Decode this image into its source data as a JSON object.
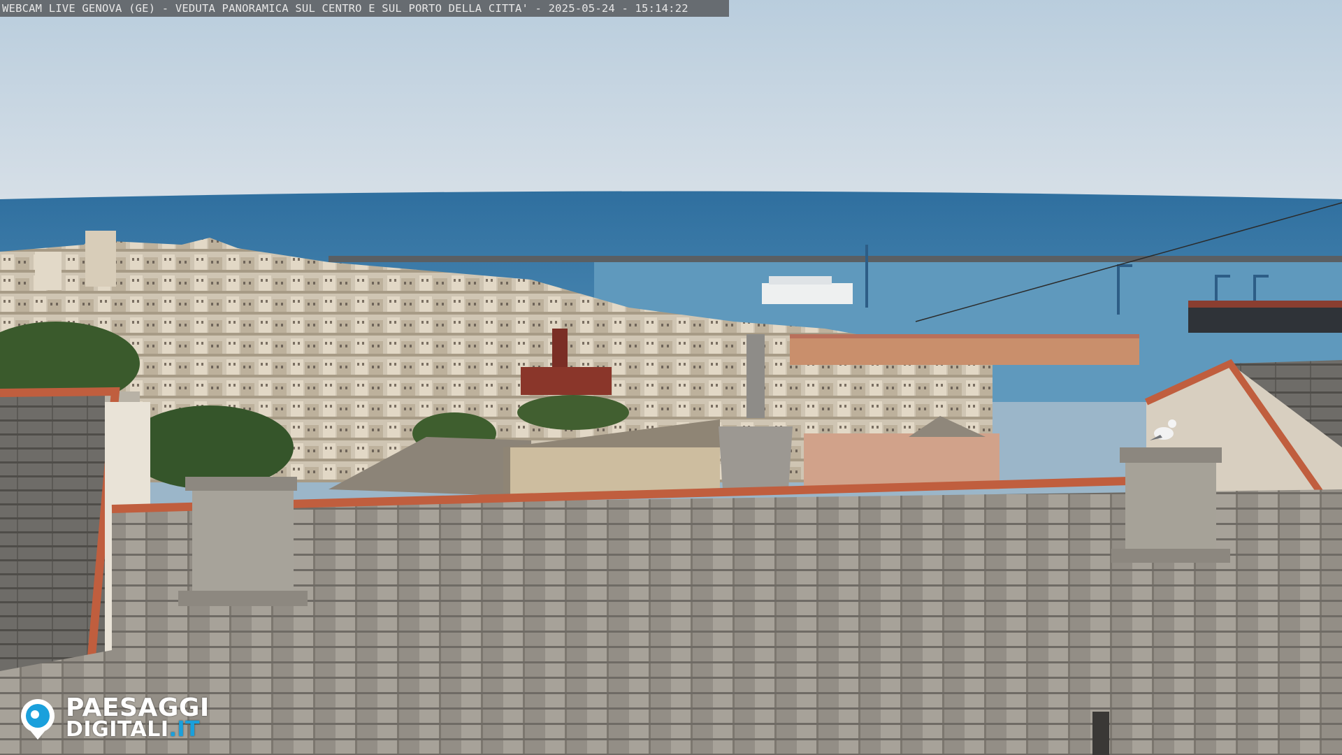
{
  "overlay": {
    "caption": "WEBCAM LIVE GENOVA (GE) - VEDUTA PANORAMICA SUL CENTRO E SUL PORTO DELLA CITTA' - 2025-05-24 - 15:14:22"
  },
  "logo": {
    "line1": "PAESAGGI",
    "line2_main": "DIGITALI",
    "line2_tld": ".IT",
    "icon": "webcam-pin-icon"
  },
  "colors": {
    "sky_top": "#c9d6e2",
    "sky_horizon": "#d3dde6",
    "sea": "#3f7fae",
    "harbor_water": "#5b98bd",
    "roof_slate": "#8f8a82",
    "roof_tile_edge": "#c05e3e",
    "logo_accent": "#1aa0dc"
  }
}
